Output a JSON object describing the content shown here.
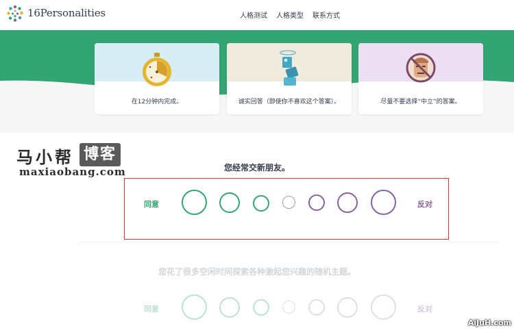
{
  "header": {
    "brand": "16Personalities",
    "nav": [
      "人格测试",
      "人格类型",
      "联系方式"
    ]
  },
  "tips": [
    {
      "icon": "stopwatch-icon",
      "text": "在12分钟内完成。"
    },
    {
      "icon": "robot-figure-icon",
      "text": "诚实回答（即使你不喜欢这个答案）。"
    },
    {
      "icon": "no-neutral-face-icon",
      "text": "尽量不要选择“中立”的答案。"
    }
  ],
  "watermark": {
    "name": "马小帮",
    "boxed": "博客",
    "domain": "maxiaobang.com",
    "corner": "AiJuH.com"
  },
  "questions": [
    {
      "text": "您经常交新朋友。",
      "agree": "同意",
      "disagree": "反对",
      "options": 7,
      "active": true
    },
    {
      "text": "您花了很多空闲时间探索各种激起您兴趣的随机主题。",
      "agree": "同意",
      "disagree": "反对",
      "options": 7,
      "active": false
    }
  ],
  "colors": {
    "agree": "#33a474",
    "disagree": "#88619a",
    "neutral": "#9b9fa8",
    "banner_green": "#33a474",
    "highlight": "#d93737"
  }
}
